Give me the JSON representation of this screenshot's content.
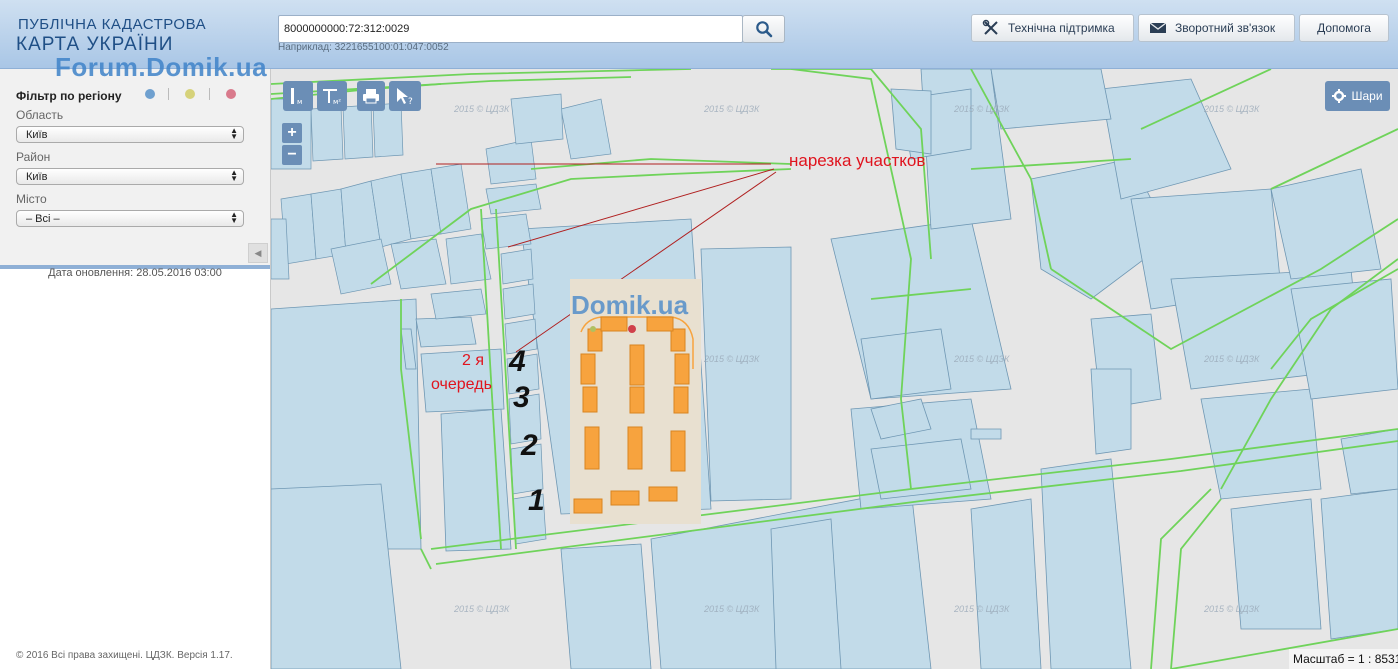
{
  "header": {
    "logo_line1": "ПУБЛІЧНА КАДАСТРОВА",
    "logo_line2": "КАРТА УКРАЇНИ",
    "search_value": "8000000000:72:312:0029",
    "search_hint": "Наприклад: 3221655100:01:047:0052",
    "buttons": {
      "support": "Технічна підтримка",
      "feedback": "Зворотний зв'язок",
      "help": "Допомога"
    }
  },
  "overlay_watermark": "Forum.Domik.ua",
  "sidebar": {
    "filter_title": "Фільтр по регіону",
    "dot_colors": [
      "#6fa0cf",
      "#d6d27a",
      "#d97a8c"
    ],
    "oblast_label": "Область",
    "oblast_value": "Київ",
    "rayon_label": "Район",
    "rayon_value": "Київ",
    "city_label": "Місто",
    "city_value": "– Всі –",
    "update": "Дата оновлення: 28.05.2016 03:00",
    "copyright": "© 2016 Всі права захищені. ЦДЗК. Версія 1.17."
  },
  "map": {
    "tools": [
      "ruler-icon",
      "area-icon",
      "print-icon",
      "identify-icon"
    ],
    "tool_units": {
      "ruler": "м",
      "area": "м²"
    },
    "zoom_in": "+",
    "zoom_out": "−",
    "layers_label": "Шари",
    "scale": "Масштаб = 1 : 8531",
    "watermark": "2015 © ЦДЗК",
    "inset_watermark": "Domik.ua",
    "annotation_cuts": "нарезка участков",
    "annotation_queue_1": "2 я",
    "annotation_queue_2": "очередь",
    "numbers": [
      "4",
      "3",
      "2",
      "1"
    ],
    "colors": {
      "parcel_fill": "#c2dbe9",
      "parcel_stroke": "#6f97b3",
      "boundary": "#6fd35a",
      "background": "#e6e6e6",
      "building": "#f7a33e"
    }
  }
}
